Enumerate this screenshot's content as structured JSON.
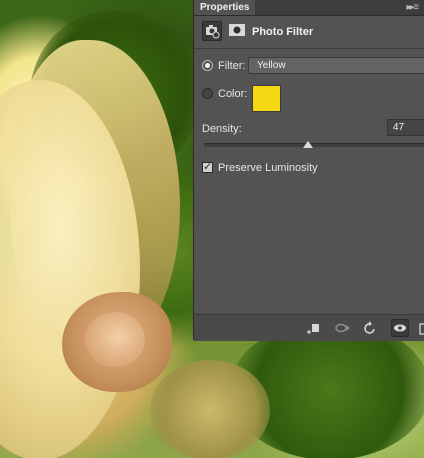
{
  "panel": {
    "tab_label": "Properties",
    "title": "Photo Filter",
    "header_icons": [
      "adjustment-camera-icon",
      "layer-mask-icon"
    ]
  },
  "filter": {
    "label": "Filter:",
    "value": "Yellow",
    "selected": true
  },
  "color": {
    "label": "Color:",
    "swatch": "#f5d813",
    "selected": false
  },
  "density": {
    "label": "Density:",
    "value": "47",
    "fraction": 0.47
  },
  "preserve": {
    "label": "Preserve Luminosity",
    "checked": true
  },
  "footer": {
    "icons": [
      "clip-to-layer-icon",
      "view-previous-state-icon",
      "reset-icon",
      "visibility-eye-icon",
      "delete-icon"
    ]
  },
  "colors": {
    "panel": "#535353",
    "accent_swatch": "#f5d813"
  }
}
